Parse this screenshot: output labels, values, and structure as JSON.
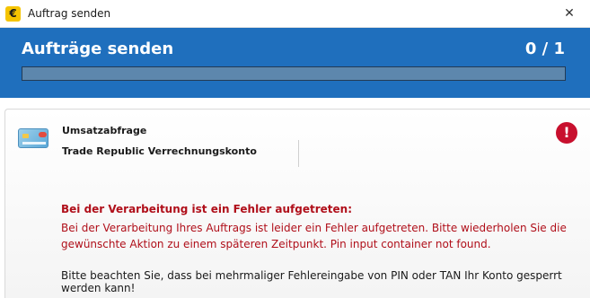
{
  "window": {
    "title": "Auftrag senden",
    "app_icon_glyph": "€",
    "close_glyph": "✕"
  },
  "header": {
    "title": "Aufträge senden",
    "counter": "0 / 1",
    "progress_fraction": 0.0,
    "accent_color": "#1f6fbd"
  },
  "job": {
    "icon": "bank-card-icon",
    "name": "Umsatzabfrage",
    "account": "Trade Republic Verrechnungskonto",
    "status_icon": "error-icon",
    "status_glyph": "!"
  },
  "error": {
    "title": "Bei der Verarbeitung ist ein Fehler aufgetreten:",
    "message": "Bei der Verarbeitung Ihres Auftrags ist leider ein Fehler aufgetreten. Bitte wiederholen Sie die gewünschte Aktion zu einem späteren Zeitpunkt. Pin input container not found.",
    "color": "#b00f1a"
  },
  "note": "Bitte beachten Sie, dass bei mehrmaliger Fehlereingabe von PIN oder TAN Ihr Konto gesperrt werden kann!"
}
